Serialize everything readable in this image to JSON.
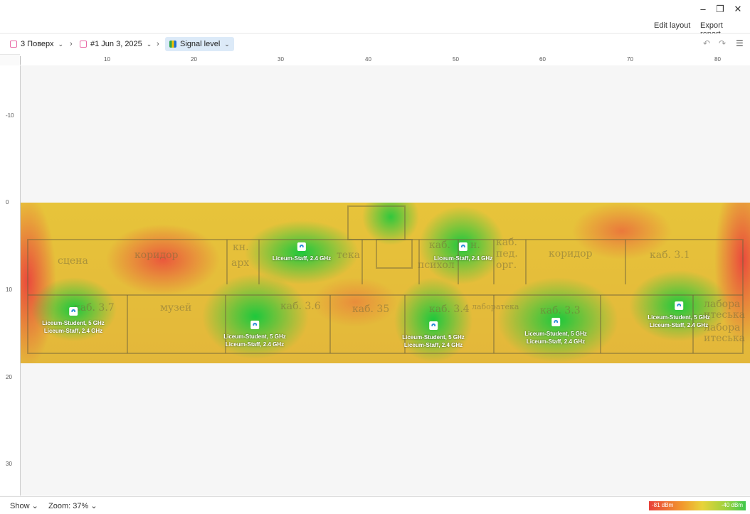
{
  "window": {
    "minimize": "–",
    "restore": "❐",
    "close": "✕",
    "edit_layout": "Edit layout",
    "export_report": "Export report..."
  },
  "breadcrumbs": {
    "floor": "3 Поверх",
    "survey": "#1 Jun 3, 2025",
    "view": "Signal level"
  },
  "ruler": {
    "top": [
      "10",
      "20",
      "30",
      "40",
      "50",
      "60",
      "70",
      "80"
    ],
    "left": [
      "-10",
      "0",
      "10",
      "20",
      "30"
    ]
  },
  "rooms": [
    "сцена",
    "коридор",
    "кн.",
    "арх",
    "тека",
    "каб.",
    "н.",
    "психол",
    "каб.",
    "пед.",
    "орг.",
    "коридор",
    "каб. 3.1",
    "каб. 3.7",
    "музей",
    "каб. 3.6",
    "каб. 35",
    "каб. 3.4",
    "лаборатека",
    "каб. 3.3",
    "лабора",
    "итеська",
    "лабора",
    "итеська"
  ],
  "access_points": [
    {
      "lines": [
        "Liceum-Student, 5 GHz",
        "Liceum-Staff, 2.4 GHz"
      ]
    },
    {
      "lines": [
        "Liceum-Staff, 2.4 GHz"
      ]
    },
    {
      "lines": [
        "Liceum-Student, 5 GHz",
        "Liceum-Staff, 2.4 GHz"
      ]
    },
    {
      "lines": [
        "Liceum-Staff, 2.4 GHz"
      ]
    },
    {
      "lines": [
        "Liceum-Student, 5 GHz",
        "Liceum-Staff, 2.4 GHz"
      ]
    },
    {
      "lines": [
        "Liceum-Student, 5 GHz",
        "Liceum-Staff, 2.4 GHz"
      ]
    },
    {
      "lines": [
        "Liceum-Student, 5 GHz",
        "Liceum-Staff, 2.4 GHz"
      ]
    }
  ],
  "status": {
    "show": "Show",
    "zoom": "Zoom: 37%"
  },
  "legend": {
    "min": "-81 dBm",
    "max": "-40 dBm",
    "colors": [
      "#e8403a",
      "#f29a2e",
      "#e8d33a",
      "#9cd13c",
      "#3fc84c"
    ]
  },
  "icons": [
    "undo-icon",
    "redo-icon",
    "settings-sliders-icon",
    "floor-icon",
    "survey-icon",
    "signal-icon",
    "wifi-ap-icon"
  ]
}
